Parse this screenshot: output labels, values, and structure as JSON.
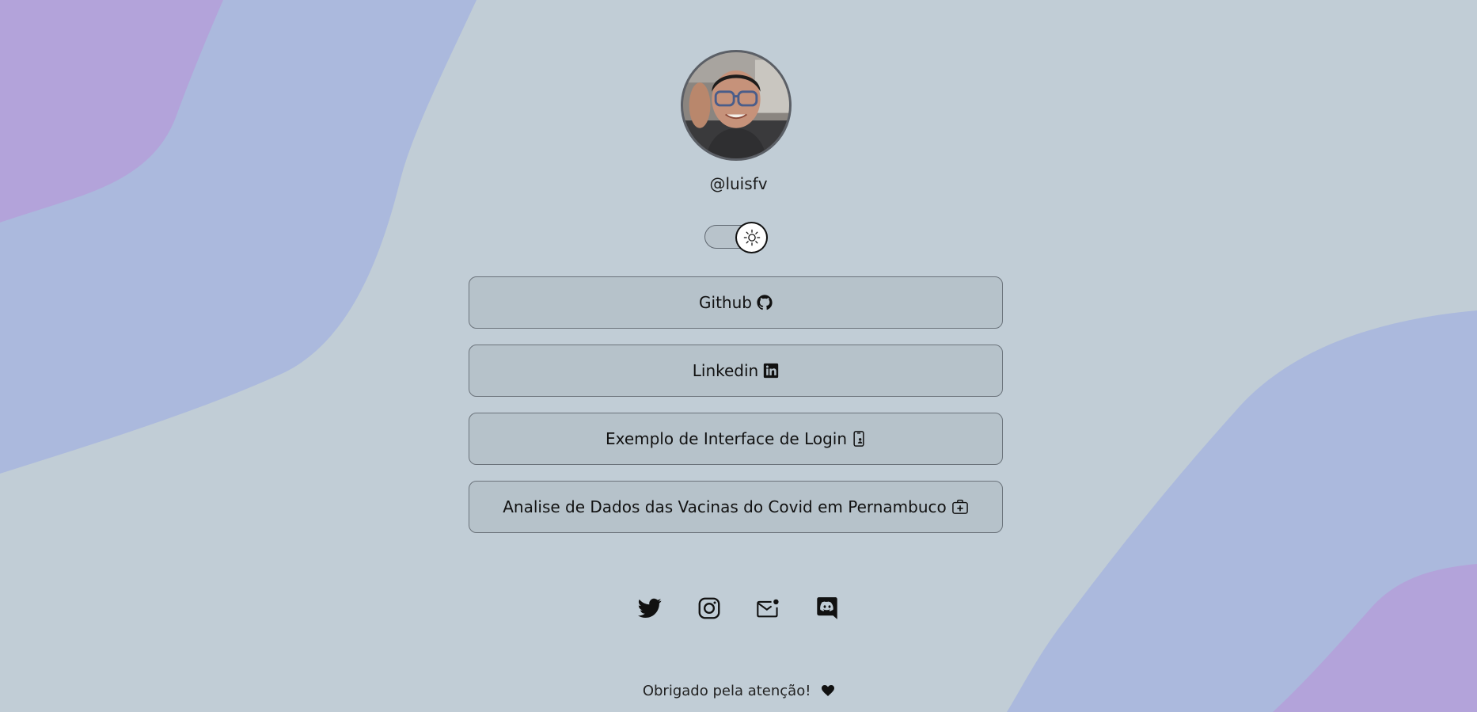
{
  "theme": {
    "background": "#c1cdd6",
    "blob_blue": "#abb9dd",
    "blob_purple": "#b3a3da",
    "button_bg": "#b6c2ca",
    "text": "#111111"
  },
  "profile": {
    "username": "@luisfv",
    "avatar_icon": "profile-photo"
  },
  "theme_toggle": {
    "icon": "sun-icon",
    "state": "light"
  },
  "links": [
    {
      "label": "Github",
      "icon": "github-icon"
    },
    {
      "label": "Linkedin",
      "icon": "linkedin-icon"
    },
    {
      "label": "Exemplo de Interface de Login",
      "icon": "phone-icon"
    },
    {
      "label": "Analise de Dados das Vacinas do Covid em Pernambuco",
      "icon": "medical-case-icon"
    }
  ],
  "socials": [
    {
      "icon": "twitter-icon"
    },
    {
      "icon": "instagram-icon"
    },
    {
      "icon": "mail-icon"
    },
    {
      "icon": "discord-icon"
    }
  ],
  "footer": {
    "text": "Obrigado pela atenção!",
    "icon": "heart-icon"
  }
}
